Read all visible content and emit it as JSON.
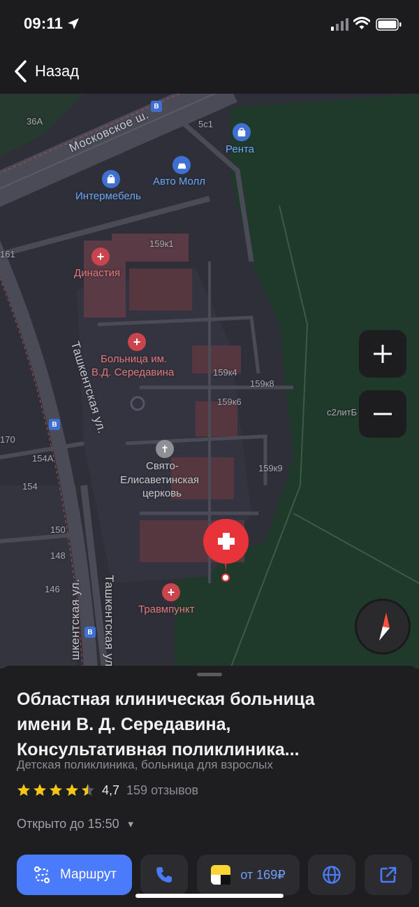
{
  "status": {
    "time": "09:11"
  },
  "nav": {
    "back_label": "Назад"
  },
  "map": {
    "streets": {
      "moskovskoe": "Московское ш.",
      "tashkentskaya_1": "Ташкентская ул.",
      "tashkentskaya_2": "Ташкентская ул.",
      "tashkentskaya_3": "шкентская ул."
    },
    "pois": {
      "renta": "Рента",
      "avto_moll": "Авто Молл",
      "intermebel": "Интермебель",
      "dinastiya": "Династия",
      "hospital_line1": "Больница им.",
      "hospital_line2": "В.Д. Середавина",
      "church_line1": "Свято-",
      "church_line2": "Елисаветинская",
      "church_line3": "церковь",
      "travmpunkt": "Травмпункт"
    },
    "houses": {
      "h36a": "36А",
      "h5c1": "5с1",
      "h159k1": "159к1",
      "h161": "161",
      "h159k4": "159к4",
      "h159k8": "159к8",
      "h159k6": "159к6",
      "h2lit": "с2литБ",
      "h170": "170",
      "h154a": "154А",
      "h154": "154",
      "h159k9": "159к9",
      "h150": "150",
      "h148": "148",
      "h146": "146"
    },
    "controls": {
      "zoom_in": "+",
      "zoom_out": "−"
    }
  },
  "place": {
    "title_line1": "Областная клиническая больница",
    "title_line2": "имени В. Д. Середавина,",
    "title_line3": "Консультативная поликлиника...",
    "category": "Детская поликлиника, больница для взрослых",
    "rating": "4,7",
    "rating_value": 4.7,
    "reviews": "159 отзывов",
    "hours": "Открыто до 15:50"
  },
  "actions": {
    "route_label": "Маршрут",
    "taxi_label": "от 169₽"
  },
  "colors": {
    "accent": "#4a7bfa",
    "map_bg": "#2f2f39",
    "park": "#1f3a2b",
    "hospital_pin": "#e8333b",
    "star": "#f5c518"
  }
}
